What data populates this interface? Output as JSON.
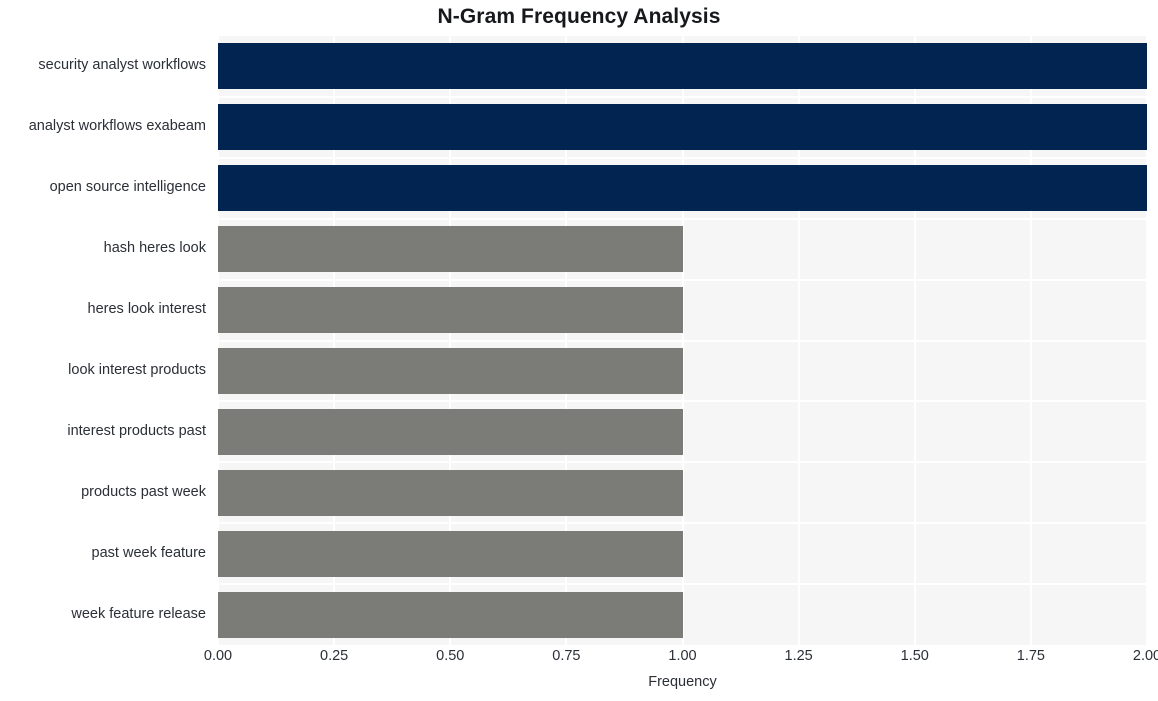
{
  "chart_data": {
    "type": "bar",
    "orientation": "horizontal",
    "title": "N-Gram Frequency Analysis",
    "xlabel": "Frequency",
    "ylabel": "",
    "xlim": [
      0,
      2
    ],
    "ylim": null,
    "grid": true,
    "legend": null,
    "xticks": [
      "0.00",
      "0.25",
      "0.50",
      "0.75",
      "1.00",
      "1.25",
      "1.50",
      "1.75",
      "2.00"
    ],
    "xtick_values": [
      0,
      0.25,
      0.5,
      0.75,
      1.0,
      1.25,
      1.5,
      1.75,
      2.0
    ],
    "categories": [
      "security analyst workflows",
      "analyst workflows exabeam",
      "open source intelligence",
      "hash heres look",
      "heres look interest",
      "look interest products",
      "interest products past",
      "products past week",
      "past week feature",
      "week feature release"
    ],
    "values": [
      2,
      2,
      2,
      1,
      1,
      1,
      1,
      1,
      1,
      1
    ],
    "bar_colors": [
      "#022450",
      "#022450",
      "#022450",
      "#7b7b78",
      "#7b7b78",
      "#7b7b78",
      "#7b7b78",
      "#7b7b78",
      "#7b7b78",
      "#7b7b78"
    ]
  },
  "style": {
    "page_background": "#ffffff",
    "plot_background": "#f6f6f7",
    "gridline_color": "#ffffff",
    "title_color": "#16181c",
    "tick_color": "#2b2f36",
    "primary_color": "#022450",
    "secondary_color": "#7b7b78"
  }
}
